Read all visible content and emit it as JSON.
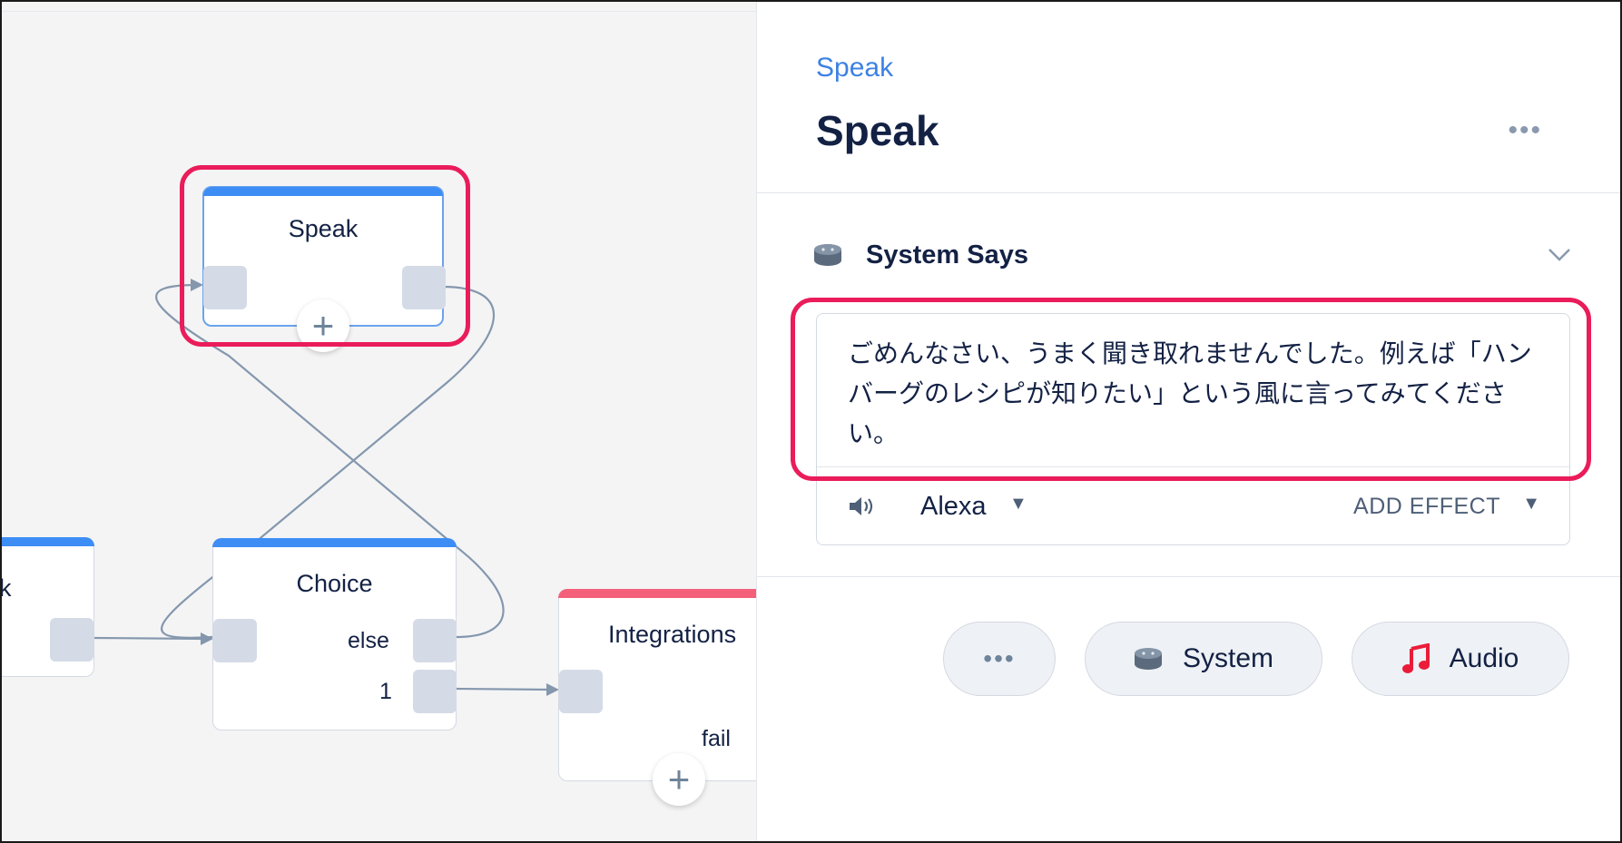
{
  "canvas": {
    "nodes": {
      "speak": {
        "title": "Speak"
      },
      "choice": {
        "title": "Choice",
        "ports": [
          "else",
          "1"
        ]
      },
      "integrations": {
        "title": "Integrations",
        "ports": [
          "fail"
        ]
      },
      "partial_left": {
        "title": "k"
      }
    },
    "colors": {
      "cap_blue": "#3d8df5",
      "cap_red": "#f4607a",
      "highlight": "#ea1c5a"
    }
  },
  "panel": {
    "breadcrumb": "Speak",
    "title": "Speak",
    "section": {
      "title": "System Says",
      "speech_text": "ごめんなさい、うまく聞き取れませんでした。例えば「ハンバーグのレシピが知りたい」という風に言ってみてください。",
      "voice": "Alexa",
      "add_effect": "ADD EFFECT"
    },
    "buttons": {
      "more": "•••",
      "system": "System",
      "audio": "Audio"
    }
  },
  "icons": {
    "speaker": "echo-speaker-icon",
    "volume": "volume-icon",
    "music": "music-note-icon",
    "chevron": "chevron-down-icon"
  }
}
